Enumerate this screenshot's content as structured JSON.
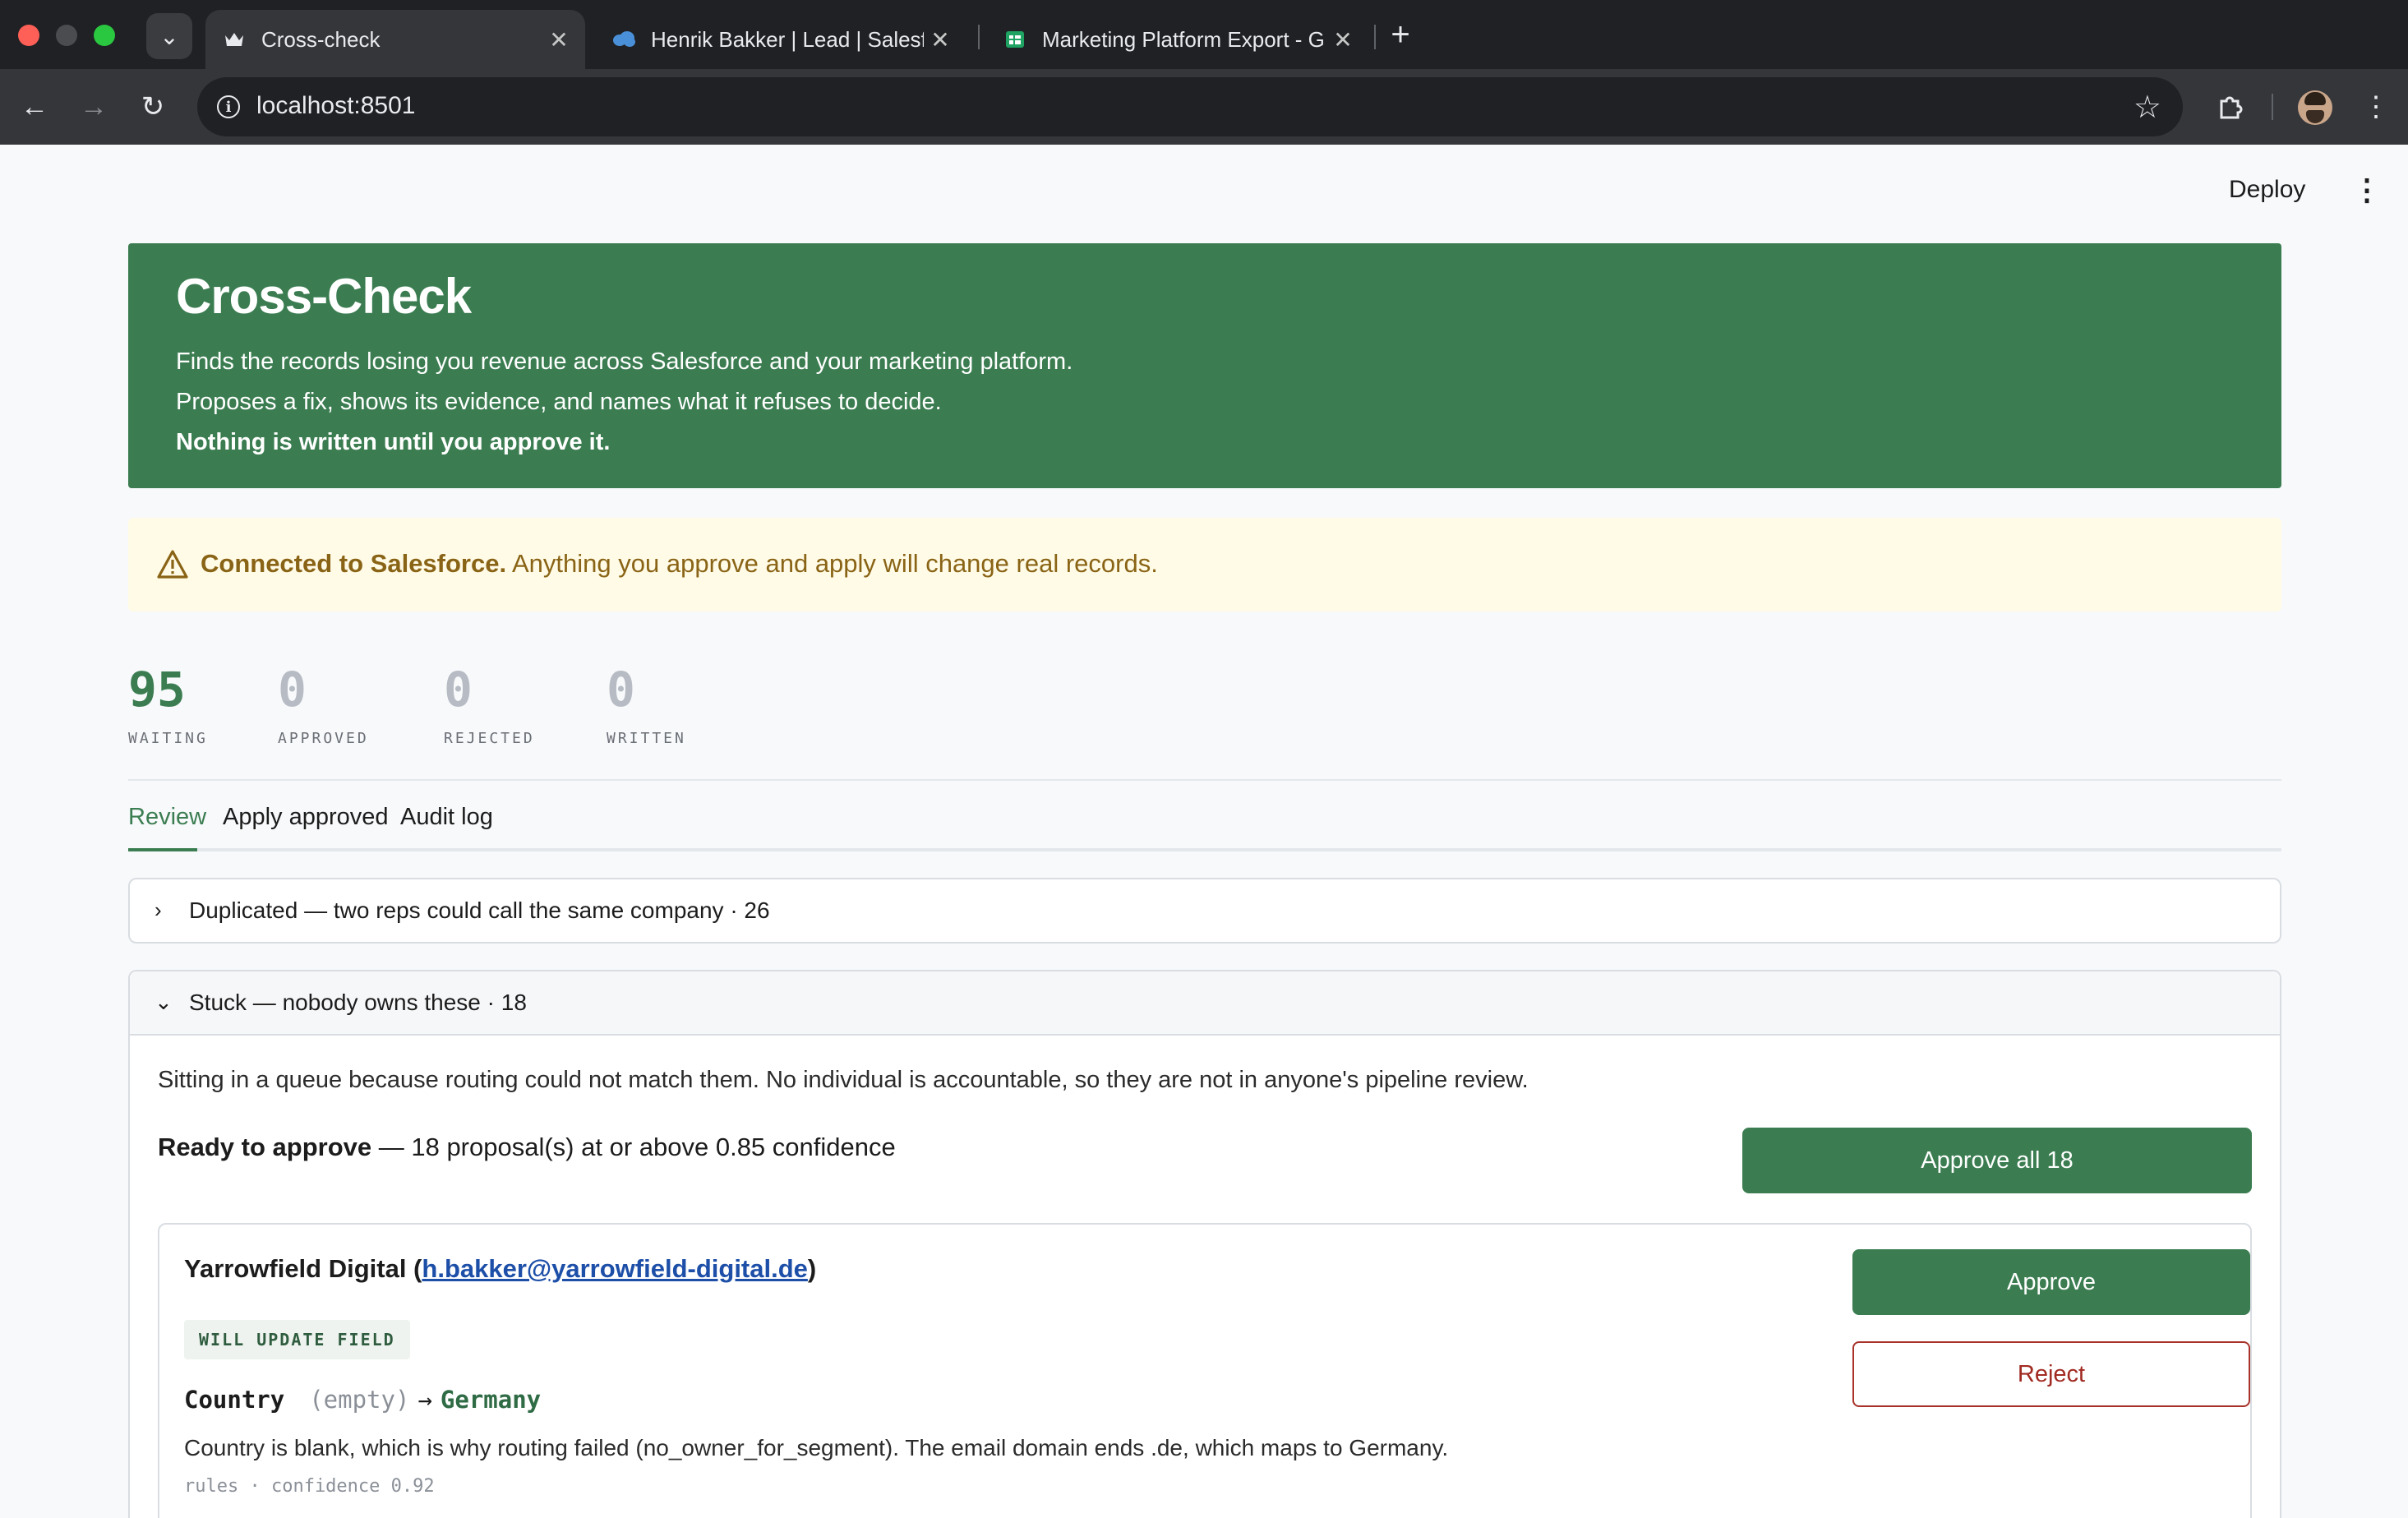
{
  "browser": {
    "tabs": [
      {
        "title": "Cross-check",
        "active": true,
        "icon": "crown-favicon"
      },
      {
        "title": "Henrik Bakker | Lead | Salesfo",
        "active": false,
        "icon": "salesforce-cloud-favicon"
      },
      {
        "title": "Marketing Platform Export - G",
        "active": false,
        "icon": "sheets-favicon"
      }
    ],
    "url": "localhost:8501"
  },
  "app": {
    "deploy_label": "Deploy",
    "hero": {
      "title": "Cross-Check",
      "line1": "Finds the records losing you revenue across Salesforce and your marketing platform.",
      "line2": "Proposes a fix, shows its evidence, and names what it refuses to decide.",
      "line3": "Nothing is written until you approve it."
    },
    "warning": {
      "bold": "Connected to Salesforce.",
      "text": " Anything you approve and apply will change real records."
    },
    "stats": [
      {
        "value": "95",
        "label": "WAITING"
      },
      {
        "value": "0",
        "label": "APPROVED"
      },
      {
        "value": "0",
        "label": "REJECTED"
      },
      {
        "value": "0",
        "label": "WRITTEN"
      }
    ],
    "tabs": [
      "Review",
      "Apply approved",
      "Audit log"
    ],
    "groups": [
      {
        "title": "Duplicated — two reps could call the same company · 26",
        "expanded": false
      },
      {
        "title": "Stuck — nobody owns these · 18",
        "expanded": true,
        "description": "Sitting in a queue because routing could not match them. No individual is accountable, so they are not in anyone's pipeline review.",
        "ready_bold": "Ready to approve",
        "ready_text": " — 18 proposal(s) at or above 0.85 confidence",
        "approve_all_label": "Approve all 18",
        "card": {
          "company": "Yarrowfield Digital (",
          "email": "h.bakker@yarrowfield-digital.de",
          "close_paren": ")",
          "badge": "WILL UPDATE FIELD",
          "field": "Country",
          "old_value": "(empty)",
          "arrow": "→",
          "new_value": "Germany",
          "reason": "Country is blank, which is why routing failed (no_owner_for_segment). The email domain ends .de, which maps to Germany.",
          "meta": "rules · confidence 0.92",
          "approve_label": "Approve",
          "reject_label": "Reject"
        }
      }
    ]
  }
}
